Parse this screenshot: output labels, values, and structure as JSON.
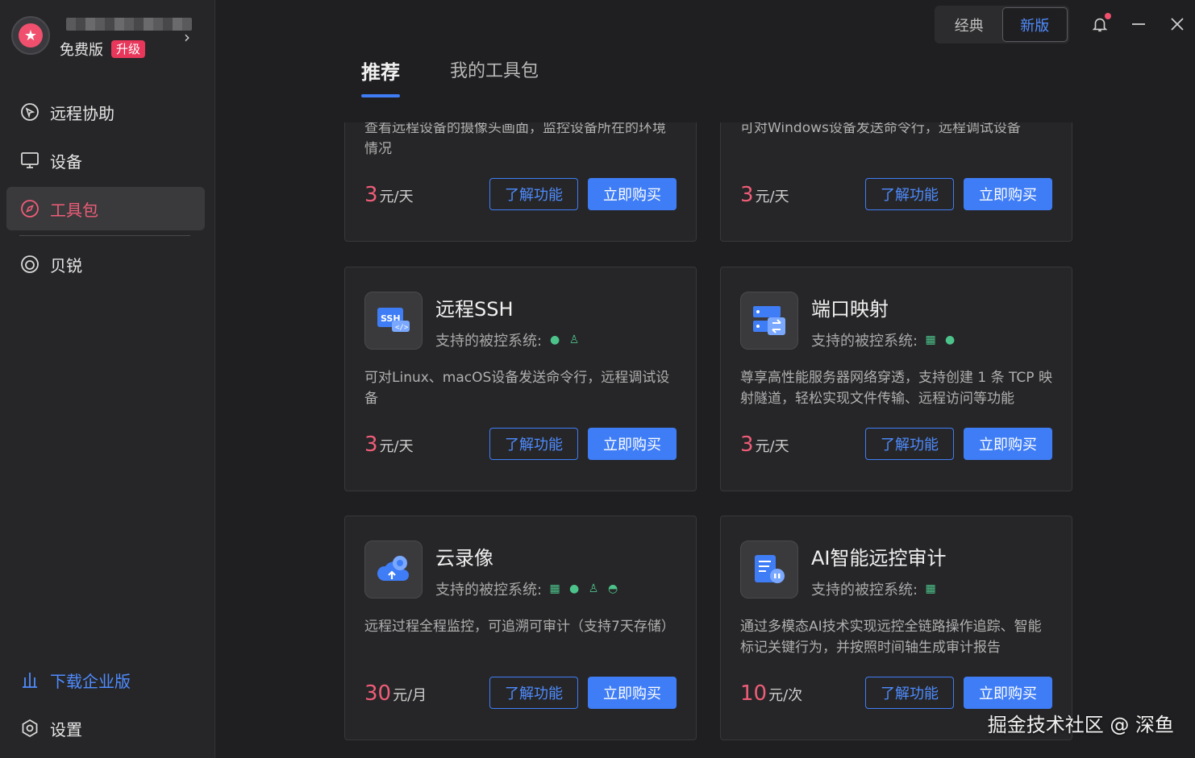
{
  "profile": {
    "plan": "免费版",
    "upgrade": "升级"
  },
  "nav": {
    "items": [
      {
        "label": "远程协助",
        "icon": "remote-assist-icon"
      },
      {
        "label": "设备",
        "icon": "device-monitor-icon"
      },
      {
        "label": "工具包",
        "icon": "compass-icon"
      },
      {
        "label": "贝锐",
        "icon": "oray-logo-icon"
      }
    ],
    "download": "下载企业版",
    "settings": "设置"
  },
  "topbar": {
    "classic": "经典",
    "new": "新版"
  },
  "tabs": [
    "推荐",
    "我的工具包"
  ],
  "cards": [
    {
      "title": "",
      "desc": "查看远程设备的摄像头画面，监控设备所在的环境情况",
      "price": "3",
      "unit": "元/天",
      "os": []
    },
    {
      "title": "",
      "desc": "可对Windows设备发送命令行，远程调试设备",
      "price": "3",
      "unit": "元/天",
      "os": []
    },
    {
      "title": "远程SSH",
      "sys_label": "支持的被控系统:",
      "desc": "可对Linux、macOS设备发送命令行，远程调试设备",
      "price": "3",
      "unit": "元/天",
      "os": [
        "apple",
        "linux"
      ]
    },
    {
      "title": "端口映射",
      "sys_label": "支持的被控系统:",
      "desc": "尊享高性能服务器网络穿透，支持创建 1 条 TCP 映射隧道，轻松实现文件传输、远程访问等功能",
      "price": "3",
      "unit": "元/天",
      "os": [
        "windows",
        "apple"
      ]
    },
    {
      "title": "云录像",
      "sys_label": "支持的被控系统:",
      "desc": "远程过程全程监控，可追溯可审计（支持7天存储）",
      "price": "30",
      "unit": "元/月",
      "os": [
        "windows",
        "apple",
        "linux",
        "android"
      ]
    },
    {
      "title": "AI智能远控审计",
      "sys_label": "支持的被控系统:",
      "desc": "通过多模态AI技术实现远控全链路操作追踪、智能标记关键行为，并按照时间轴生成审计报告",
      "price": "10",
      "unit": "元/次",
      "os": [
        "windows"
      ]
    }
  ],
  "buttons": {
    "learn": "了解功能",
    "buy": "立即购买"
  },
  "watermark": "掘金技术社区 @ 深鱼",
  "colors": {
    "accent": "#3f7df6",
    "price": "#ef5d78",
    "active_nav": "#ef5d78"
  }
}
